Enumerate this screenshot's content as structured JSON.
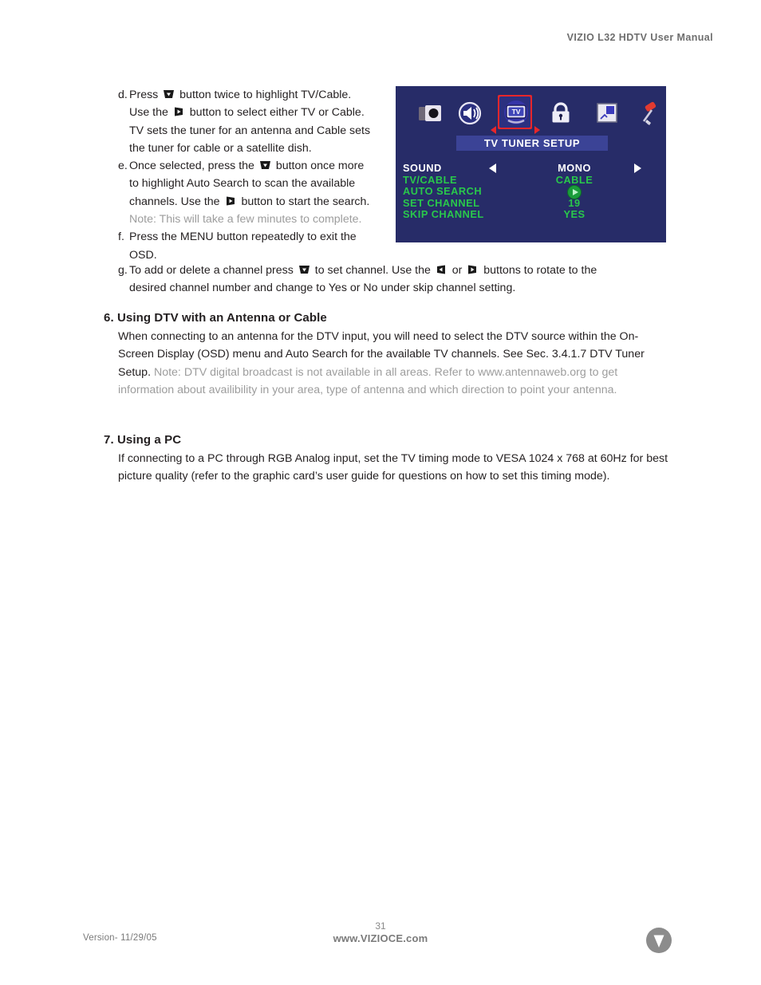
{
  "header": {
    "title": "VIZIO L32 HDTV User Manual"
  },
  "steps": [
    {
      "label": "d.",
      "lines": [
        [
          {
            "type": "text",
            "text": "Press "
          },
          {
            "type": "icon",
            "icon": "down-arrow-button-icon"
          },
          {
            "type": "text",
            "text": " button twice to highlight TV/Cable."
          }
        ],
        [
          {
            "type": "text",
            "text": "Use the "
          },
          {
            "type": "icon",
            "icon": "right-arrow-button-icon"
          },
          {
            "type": "text",
            "text": " button to select either TV or Cable."
          }
        ],
        [
          {
            "type": "text",
            "text": "TV sets the tuner for an antenna and Cable sets"
          }
        ],
        [
          {
            "type": "text",
            "text": "the tuner for cable or a satellite dish."
          }
        ]
      ]
    },
    {
      "label": "e.",
      "lines": [
        [
          {
            "type": "text",
            "text": "Once selected, press the "
          },
          {
            "type": "icon",
            "icon": "down-arrow-button-icon"
          },
          {
            "type": "text",
            "text": " button once more"
          }
        ],
        [
          {
            "type": "text",
            "text": "to highlight Auto Search to scan the available"
          }
        ],
        [
          {
            "type": "text",
            "text": "channels. Use the "
          },
          {
            "type": "icon",
            "icon": "right-arrow-button-icon"
          },
          {
            "type": "text",
            "text": " button to start the search."
          }
        ],
        [
          {
            "type": "text",
            "text": "Note: This will take a few minutes to complete.",
            "style": "gray"
          }
        ]
      ]
    },
    {
      "label": "f.",
      "lines": [
        [
          {
            "type": "text",
            "text": "Press the MENU button repeatedly to exit the"
          }
        ],
        [
          {
            "type": "text",
            "text": "OSD."
          }
        ]
      ]
    }
  ],
  "wide_steps": [
    {
      "label": "g.",
      "lines": [
        [
          {
            "type": "text",
            "text": "To add or delete a channel press "
          },
          {
            "type": "icon",
            "icon": "down-arrow-button-icon"
          },
          {
            "type": "text",
            "text": " to set channel.  Use the "
          },
          {
            "type": "icon",
            "icon": "left-arrow-button-icon"
          },
          {
            "type": "text",
            "text": " or "
          },
          {
            "type": "icon",
            "icon": "right-arrow-button-icon"
          },
          {
            "type": "text",
            "text": " buttons to rotate to the"
          }
        ],
        [
          {
            "type": "text",
            "text": "desired channel number and change to Yes or No under skip channel setting."
          }
        ]
      ]
    }
  ],
  "osd": {
    "background_color": "#272c68",
    "title": "TV TUNER SETUP",
    "title_bar_color": "#3b4396",
    "selection_color": "#e8262a",
    "label_color": "#29c84b",
    "active_color": "#ffffff",
    "icons": [
      {
        "name": "picture-icon",
        "selected": false
      },
      {
        "name": "audio-speaker-icon",
        "selected": false
      },
      {
        "name": "tv-tuner-icon",
        "selected": true
      },
      {
        "name": "parental-lock-icon",
        "selected": false
      },
      {
        "name": "pip-setup-icon",
        "selected": false
      },
      {
        "name": "tools-hammer-icon",
        "selected": false
      }
    ],
    "rows": [
      {
        "label": "SOUND",
        "value": "MONO",
        "active": true,
        "arrows": true
      },
      {
        "label": "TV/CABLE",
        "value": "CABLE",
        "active": false,
        "arrows": false
      },
      {
        "label": "AUTO SEARCH",
        "value": "",
        "active": false,
        "arrows": false,
        "play_button": true
      },
      {
        "label": "SET CHANNEL",
        "value": "19",
        "active": false,
        "arrows": false
      },
      {
        "label": "SKIP CHANNEL",
        "value": "YES",
        "active": false,
        "arrows": false
      }
    ]
  },
  "sections": [
    {
      "title": "6. Using DTV with an Antenna or Cable",
      "body": [
        {
          "text": "When connecting to an antenna for the DTV input, you will need to select the DTV source within ",
          "style": "dark"
        },
        {
          "text": "the On-Screen Display (OSD) menu and Auto Search for the available TV channels.  See Sec. 3.4.1.7 ",
          "style": "dark"
        },
        {
          "text": "DTV Tuner Setup.  ",
          "style": "dark"
        },
        {
          "text": "Note: DTV digital broadcast is not available in all areas.  Refer to www.antennaweb.org to get information about availibility in your area, type of antenna and which direction to point your antenna.",
          "style": "gray"
        }
      ]
    },
    {
      "title": "7. Using a PC",
      "body": [
        {
          "text": "If connecting to a PC through RGB Analog input, set the TV timing mode to VESA 1024 x 768 at 60Hz for best picture quality (refer to the graphic card’s user guide for questions on how to set this timing mode).",
          "style": "dark"
        }
      ]
    }
  ],
  "footer": {
    "version": "Version- 11/29/05",
    "page_number": "31",
    "url": "www.VIZIOCE.com",
    "logo": "vizio-v-logo-icon"
  }
}
